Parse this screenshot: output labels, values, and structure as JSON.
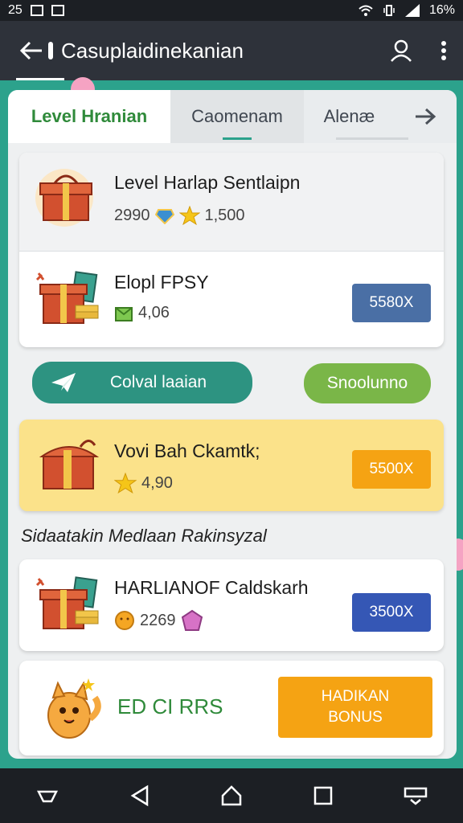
{
  "status": {
    "time": "25",
    "battery": "16%"
  },
  "app_bar": {
    "title": "Casuplaidinekanian"
  },
  "tabs": [
    {
      "label": "Level Hranian"
    },
    {
      "label": "Caomenam"
    },
    {
      "label": "Alenæ"
    }
  ],
  "card1": {
    "title": "Level Harlap Sentlaipn",
    "value1": "2990",
    "value2": "1,500"
  },
  "card2": {
    "title": "Elopl FPSY",
    "value": "4,06",
    "button": "5580X"
  },
  "buttons": {
    "left": "Colval laaian",
    "right": "Snoolunno"
  },
  "card3": {
    "title": "Vovi Bah Ckamtk;",
    "value": "4,90",
    "button": "5500X"
  },
  "section_label": "Sidaatakin Medlaan Rakinsyzal",
  "card4": {
    "title": "HARLIANOF Caldskarh",
    "value": "2269",
    "button": "3500X"
  },
  "card5": {
    "label": "ED CI RRS",
    "button": "HADIKAN BONUS"
  },
  "colors": {
    "teal": "#2ca28c",
    "blue_button": "#4a6fa5",
    "orange_button": "#f5a313",
    "green_button": "#7ab648",
    "yellow_card": "#fbe28a"
  }
}
